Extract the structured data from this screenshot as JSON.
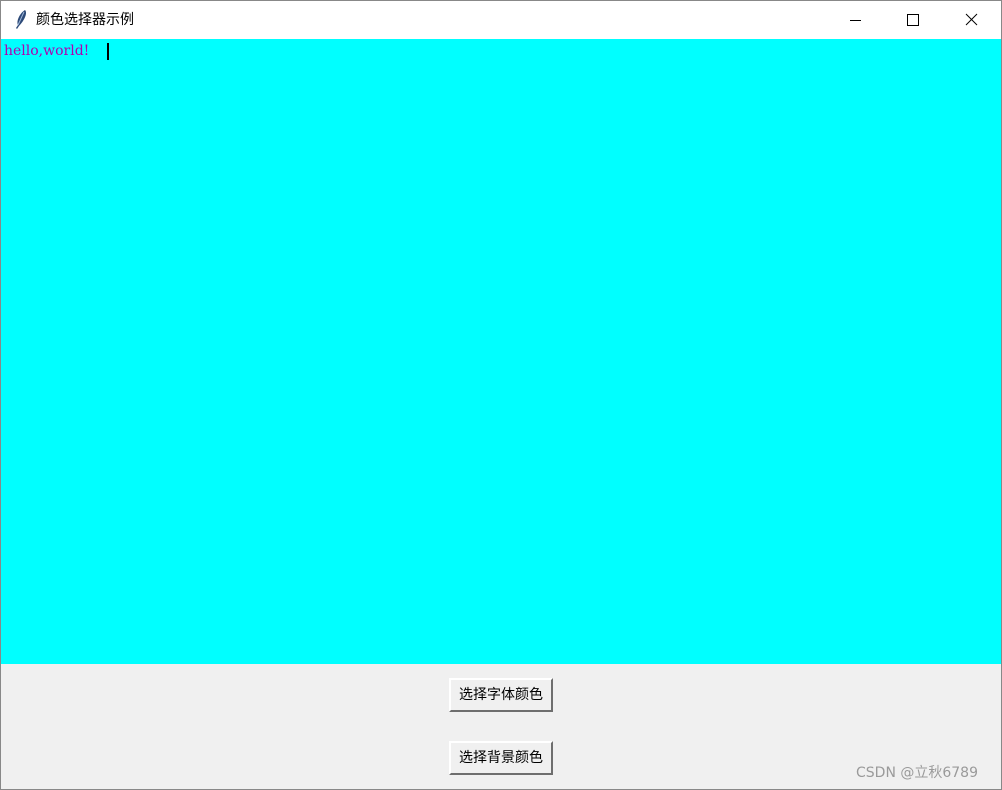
{
  "window": {
    "title": "颜色选择器示例",
    "app_icon": "tk-feather-icon",
    "controls": [
      "minimize-icon",
      "maximize-icon",
      "close-icon"
    ]
  },
  "editor": {
    "content": "hello,world!",
    "text_color": "#b000b0",
    "background_color": "#00ffff"
  },
  "buttons": {
    "font_color_label": "选择字体颜色",
    "background_color_label": "选择背景颜色"
  },
  "watermark": {
    "text": "CSDN @立秋6789"
  }
}
